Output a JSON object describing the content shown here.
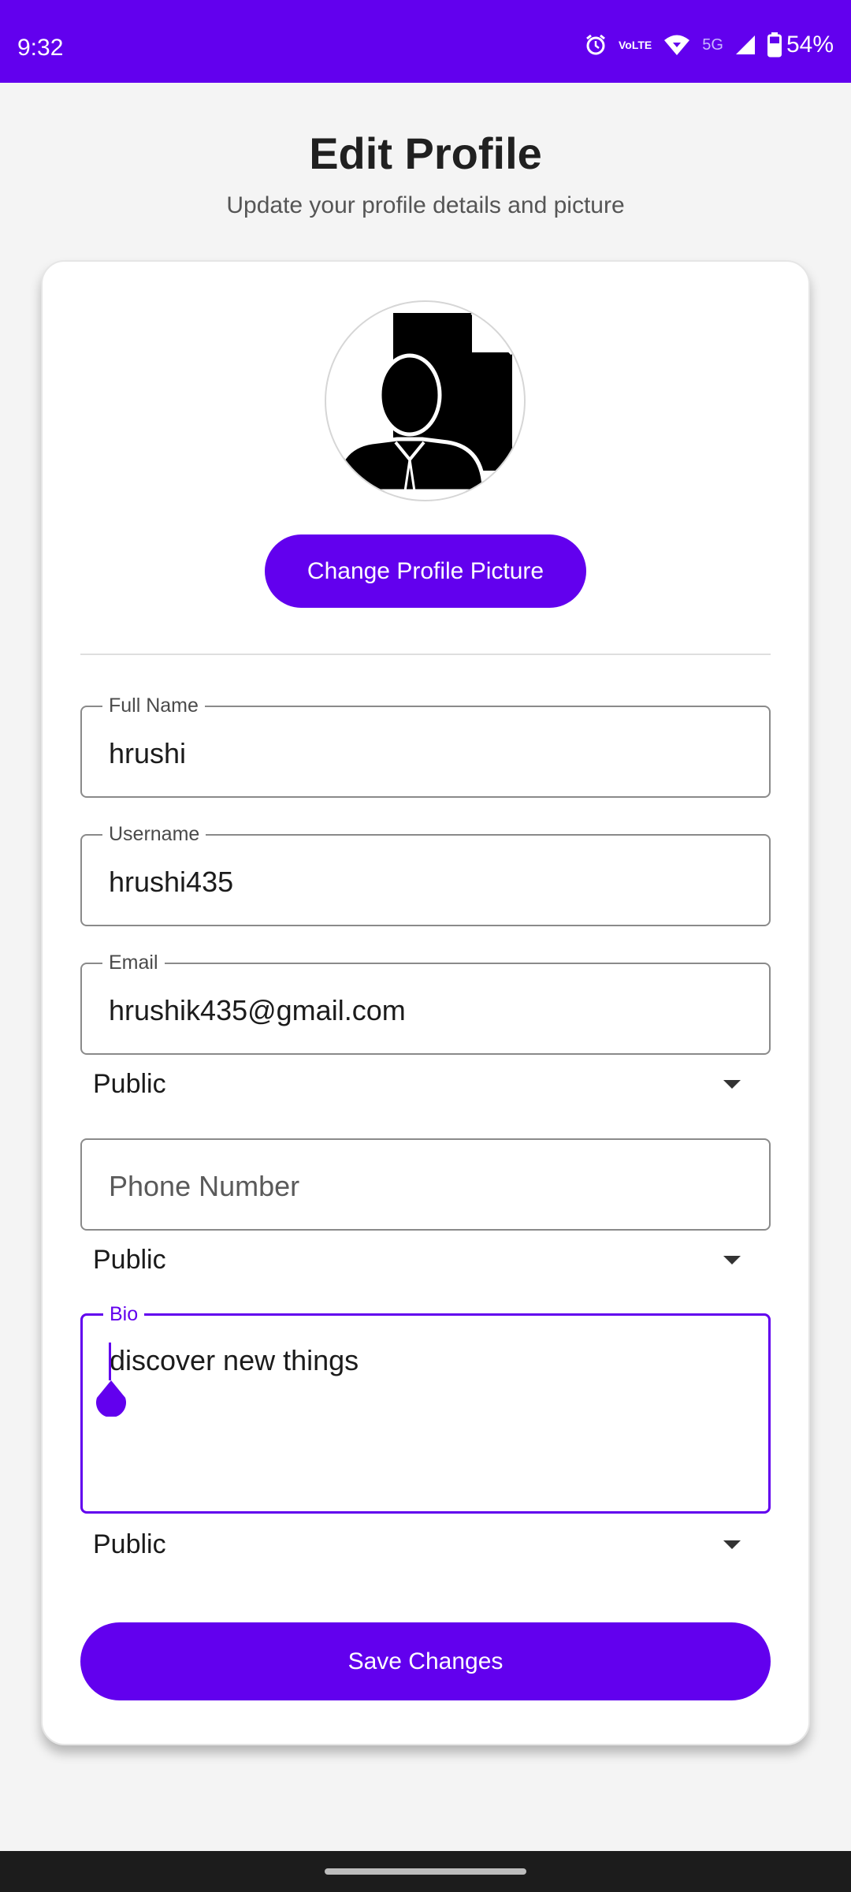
{
  "status_bar": {
    "time": "9:32",
    "volte_top": "Vo",
    "volte_bottom": "LTE",
    "network_label": "5G",
    "battery": "54%",
    "icons": [
      "alarm-icon",
      "volte-icon",
      "wifi-icon",
      "signal-icon",
      "battery-icon"
    ]
  },
  "header": {
    "title": "Edit Profile",
    "subtitle": "Update your profile details and picture"
  },
  "profile": {
    "avatar_icon": "person-document-icon",
    "change_picture_label": "Change Profile Picture"
  },
  "fields": {
    "full_name": {
      "label": "Full Name",
      "value": "hrushi"
    },
    "username": {
      "label": "Username",
      "value": "hrushi435"
    },
    "email": {
      "label": "Email",
      "value": "hrushik435@gmail.com",
      "visibility": "Public"
    },
    "phone": {
      "placeholder": "Phone Number",
      "visibility": "Public"
    },
    "bio": {
      "label": "Bio",
      "value": "discover new things",
      "visibility": "Public"
    }
  },
  "actions": {
    "save_label": "Save Changes"
  },
  "colors": {
    "accent": "#6200ee",
    "background": "#f4f4f4",
    "card": "#ffffff"
  }
}
